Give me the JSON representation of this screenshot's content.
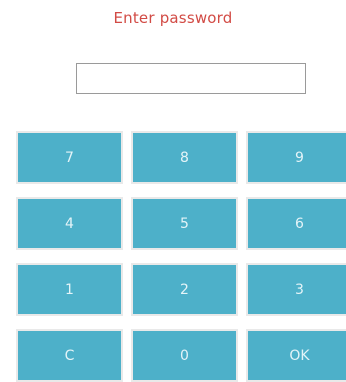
{
  "dialog": {
    "title": "Enter password"
  },
  "password_field": {
    "value": "",
    "placeholder": ""
  },
  "colors": {
    "title_red": "#d24b45",
    "key_blue": "#4db0c9",
    "key_text": "#e4f4f8"
  },
  "keypad": {
    "keys": [
      {
        "label": "7"
      },
      {
        "label": "8"
      },
      {
        "label": "9"
      },
      {
        "label": "4"
      },
      {
        "label": "5"
      },
      {
        "label": "6"
      },
      {
        "label": "1"
      },
      {
        "label": "2"
      },
      {
        "label": "3"
      },
      {
        "label": "C"
      },
      {
        "label": "0"
      },
      {
        "label": "OK"
      }
    ]
  }
}
